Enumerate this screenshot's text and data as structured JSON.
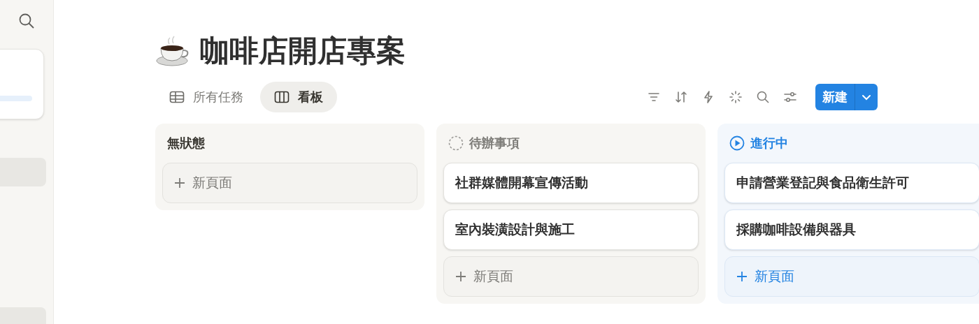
{
  "page": {
    "title": "咖啡店開店專案"
  },
  "views": [
    {
      "label": "所有任務",
      "kind": "table",
      "selected": false
    },
    {
      "label": "看板",
      "kind": "board",
      "selected": true
    }
  ],
  "toolbar": {
    "new_button": "新建"
  },
  "columns": [
    {
      "title": "無狀態",
      "kind": "none",
      "add_label": "新頁面"
    },
    {
      "title": "待辦事項",
      "kind": "todo",
      "cards": [
        "社群媒體開幕宣傳活動",
        "室內裝潢設計與施工"
      ],
      "add_label": "新頁面"
    },
    {
      "title": "進行中",
      "kind": "in_progress",
      "cards": [
        "申請營業登記與食品衛生許可",
        "採購咖啡設備與器具"
      ],
      "add_label": "新頁面"
    }
  ]
}
